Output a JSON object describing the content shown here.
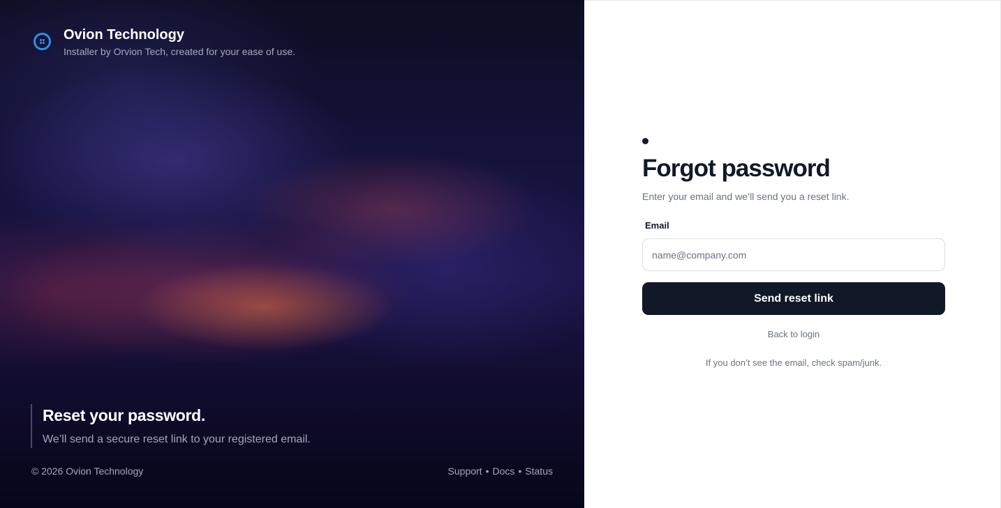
{
  "brand": {
    "name": "Ovion Technology",
    "tagline": "Installer by Orvion Tech, created for your ease of use.",
    "icon": "logo-grid-icon",
    "color": "#2f8fe8"
  },
  "hero": {
    "heading": "Reset your password.",
    "text": "We’ll send a secure reset link to your registered email."
  },
  "footer": {
    "copyright": "© 2026 Ovion Technology",
    "links": [
      "Support",
      "Docs",
      "Status"
    ],
    "separator": "•"
  },
  "form": {
    "title": "Forgot password",
    "subtitle": "Enter your email and we’ll send you a reset link.",
    "email_label": "Email",
    "email_value": "",
    "email_placeholder": "name@company.com",
    "submit_label": "Send reset link",
    "back_label": "Back to login",
    "hint": "If you don’t see the email, check spam/junk.",
    "primary_color": "#111827"
  }
}
